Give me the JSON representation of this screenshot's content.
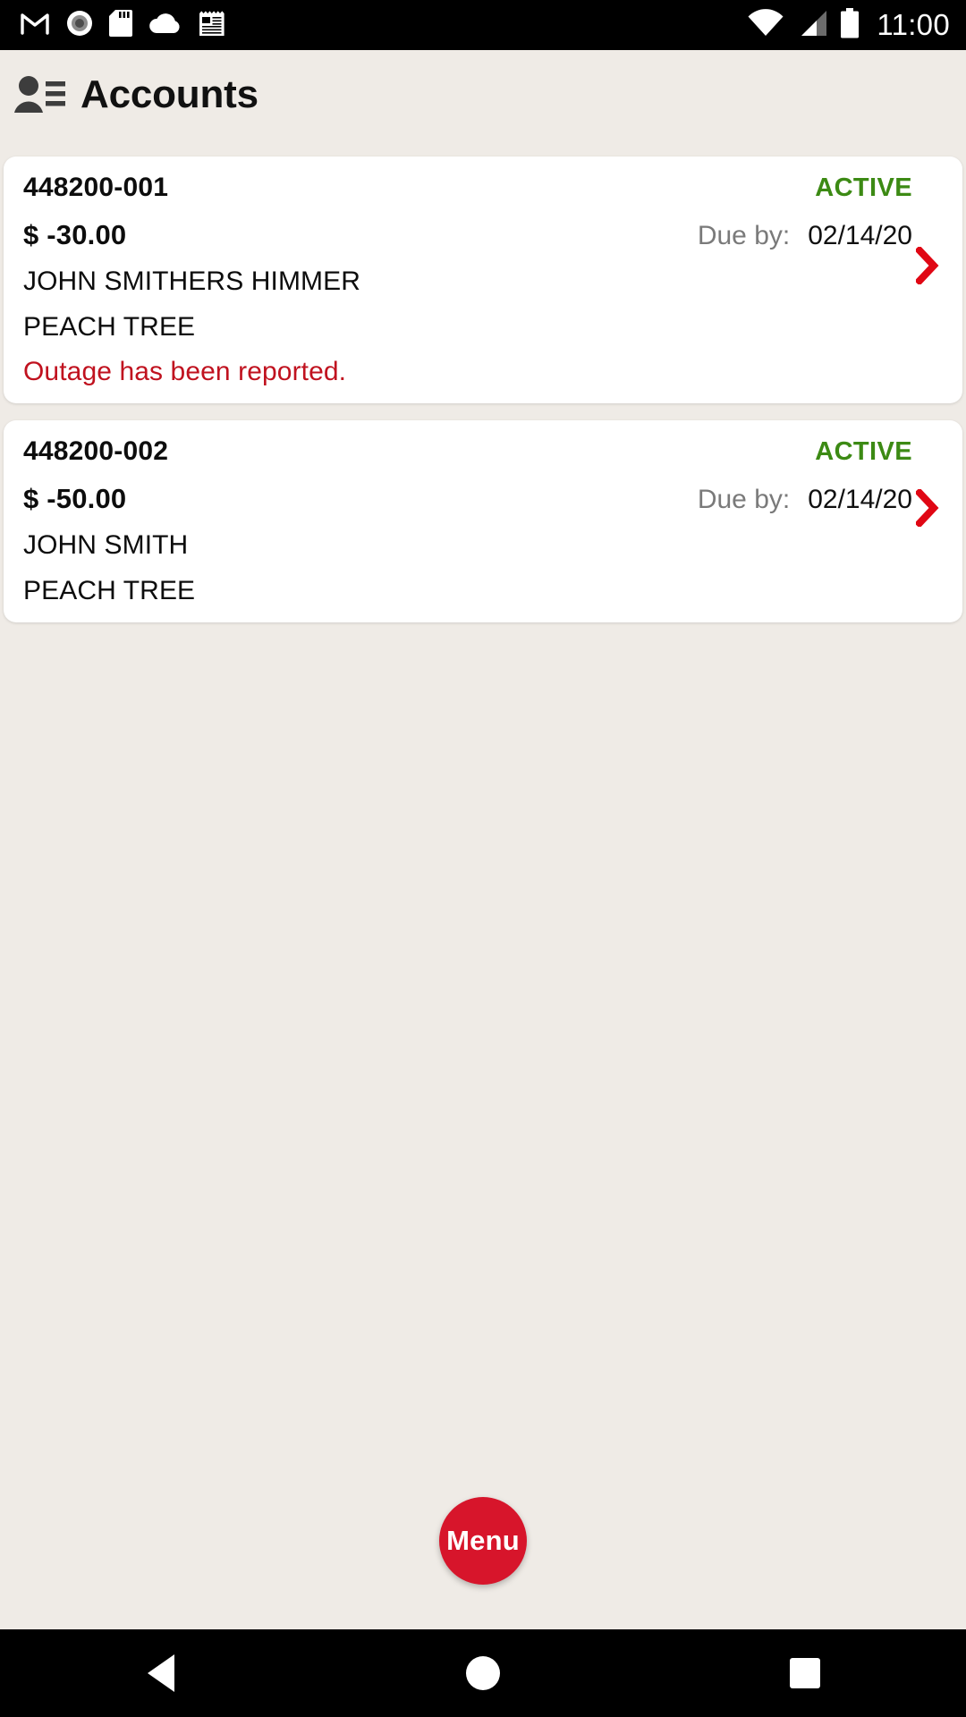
{
  "status_bar": {
    "time": "11:00",
    "left_icons": [
      {
        "name": "gmail-icon"
      },
      {
        "name": "record-circle-icon"
      },
      {
        "name": "sd-card-icon"
      },
      {
        "name": "cloud-icon"
      },
      {
        "name": "news-icon"
      }
    ],
    "right_icons": [
      {
        "name": "wifi-icon"
      },
      {
        "name": "cellular-signal-icon"
      },
      {
        "name": "battery-icon"
      }
    ],
    "background": "#000000"
  },
  "app_bar": {
    "title": "Accounts",
    "icon": "accounts-contact-icon",
    "background": "#efebe6"
  },
  "colors": {
    "page_background": "#efebe6",
    "card_background": "#ffffff",
    "status_active": "#3c8a14",
    "alert_red": "#c0121f",
    "chevron_red": "#e00714",
    "fab_red": "#d7152b",
    "due_label_gray": "#7a7a7a"
  },
  "accounts": [
    {
      "account_number": "448200-001",
      "status": "ACTIVE",
      "amount": "$ -30.00",
      "due_label": "Due by:",
      "due_date": "02/14/20",
      "customer_name": "JOHN SMITHERS HIMMER",
      "location": "PEACH TREE",
      "alert": "Outage has been reported."
    },
    {
      "account_number": "448200-002",
      "status": "ACTIVE",
      "amount": "$ -50.00",
      "due_label": "Due by:",
      "due_date": "02/14/20",
      "customer_name": "JOHN SMITH",
      "location": "PEACH TREE",
      "alert": ""
    }
  ],
  "fab": {
    "label": "Menu"
  },
  "nav_bar": {
    "back": "back-button",
    "home": "home-button",
    "recents": "recents-button"
  }
}
